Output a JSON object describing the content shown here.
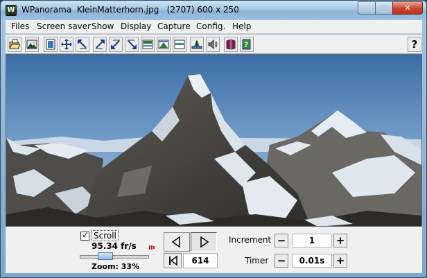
{
  "window": {
    "title": "WPanorama  KleinMatterhorn.jpg   (2707) 600 x 250",
    "app_icon_letter": "W",
    "controls": {
      "minimize": "–",
      "maximize": "□",
      "close": "✕"
    }
  },
  "menu": {
    "items": [
      "Files",
      "Screen saver",
      "Show",
      "Display",
      "Capture",
      "Config.",
      "Help"
    ]
  },
  "toolbar": {
    "buttons": [
      "open-file-icon",
      "picture-icon",
      "fit-window-icon",
      "center-move-icon",
      "arrow-up-left-icon",
      "arrow-up-right-icon",
      "arrow-down-left-icon",
      "arrow-down-right-icon",
      "screen-top-icon",
      "screen-middle-icon",
      "screen-bottom-icon",
      "picture-info-icon",
      "speaker-icon",
      "book-icon",
      "help-book-icon"
    ],
    "help_label": "?"
  },
  "panel": {
    "scroll_label": "Scroll",
    "scroll_checked": "✓",
    "fps": "95.34 fr/s",
    "zoom": "Zoom: 33%",
    "zoom_slider_level": 0.33,
    "position": "614",
    "increment_label": "Increment",
    "increment_value": "1",
    "timer_label": "Timer",
    "timer_value": "0.01s",
    "minus": "−",
    "plus": "+"
  },
  "colors": {
    "sky_top": "#3c6fa8",
    "sky_bottom": "#a8c8e0",
    "rock": "#5b5a55",
    "snow": "#e8eef2"
  }
}
